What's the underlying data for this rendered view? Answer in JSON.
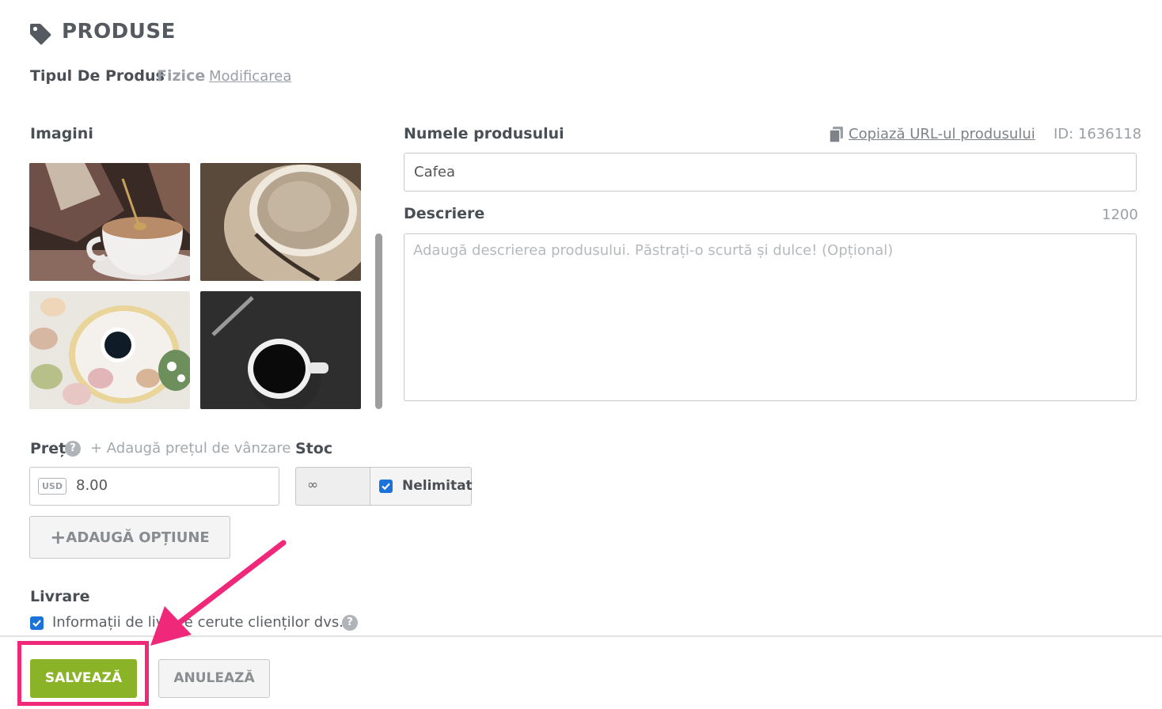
{
  "header": {
    "title": "PRODUSE",
    "icon": "tag-icon"
  },
  "product_type": {
    "label": "Tipul De Produs",
    "value": "Fizice",
    "change_link": "Modificarea"
  },
  "images": {
    "label": "Imagini",
    "items": [
      {
        "name": "coffee-cup-spoon-image"
      },
      {
        "name": "coffee-saucer-image"
      },
      {
        "name": "macarons-coffee-image"
      },
      {
        "name": "black-coffee-pen-image"
      }
    ]
  },
  "product_name": {
    "label": "Numele produsului",
    "copy_link": "Copiază URL-ul produsului",
    "id_text": "ID: 1636118",
    "value": "Cafea"
  },
  "description": {
    "label": "Descriere",
    "count": "1200",
    "placeholder": "Adaugă descrierea produsului. Păstrați-o scurtă și dulce! (Opțional)"
  },
  "price": {
    "label": "Preț",
    "add_sale": "+ Adaugă prețul de vânzare",
    "currency": "USD",
    "value": "8.00"
  },
  "stock": {
    "label": "Stoc",
    "value": "∞",
    "unlimited_label": "Nelimitat",
    "unlimited_checked": true
  },
  "add_option": {
    "label": "ADAUGĂ OPȚIUNE",
    "plus": "+"
  },
  "shipping": {
    "label": "Livrare",
    "checkbox_label": "Informații de livrare cerute clienților dvs.",
    "checked": true
  },
  "footer": {
    "save": "SALVEAZĂ",
    "cancel": "ANULEAZĂ"
  },
  "colors": {
    "accent_green": "#8ab327",
    "checkbox_blue": "#1b72d9",
    "highlight_pink": "#f0287a"
  }
}
